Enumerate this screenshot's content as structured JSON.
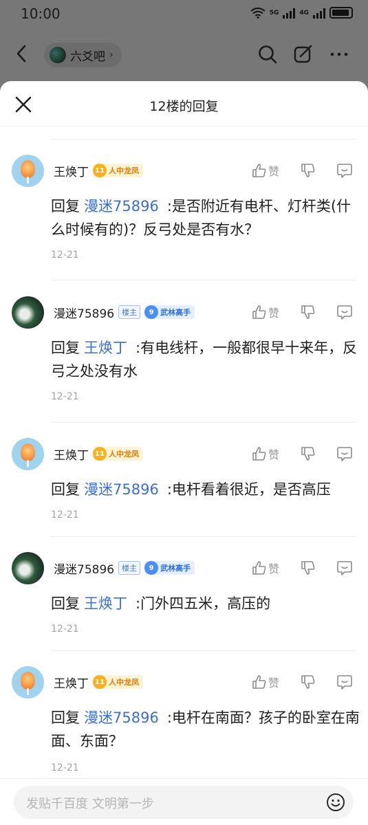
{
  "status": {
    "time": "10:00",
    "sig1": "5G",
    "sig2": "4G"
  },
  "topbar": {
    "forum_name": "六爻吧"
  },
  "sheet": {
    "title": "12楼的回复"
  },
  "replies": [
    {
      "user": "王焕丁",
      "badge_level": "11",
      "badge_title": "人中龙凤",
      "is_owner": false,
      "like_label": "赞",
      "prefix": "回复",
      "target": "漫迷75896",
      "text": ":是否附近有电杆、灯杆类(什么时候有的)？反弓处是否有水？",
      "date": "12-21"
    },
    {
      "user": "漫迷75896",
      "owner_label": "楼主",
      "badge_level": "9",
      "badge_title": "武林高手",
      "is_owner": true,
      "like_label": "赞",
      "prefix": "回复",
      "target": "王焕丁",
      "text": ":有电线杆，一般都很早十来年，反弓之处没有水",
      "date": "12-21"
    },
    {
      "user": "王焕丁",
      "badge_level": "11",
      "badge_title": "人中龙凤",
      "is_owner": false,
      "like_label": "赞",
      "prefix": "回复",
      "target": "漫迷75896",
      "text": ":电杆看着很近，是否高压",
      "date": "12-21"
    },
    {
      "user": "漫迷75896",
      "owner_label": "楼主",
      "badge_level": "9",
      "badge_title": "武林高手",
      "is_owner": true,
      "like_label": "赞",
      "prefix": "回复",
      "target": "王焕丁",
      "text": ":门外四五米，高压的",
      "date": "12-21"
    },
    {
      "user": "王焕丁",
      "badge_level": "11",
      "badge_title": "人中龙凤",
      "is_owner": false,
      "like_label": "赞",
      "prefix": "回复",
      "target": "漫迷75896",
      "text": ":电杆在南面？孩子的卧室在南面、东面？",
      "date": "12-21"
    }
  ],
  "input": {
    "placeholder": "发贴千百度 文明第一步"
  }
}
